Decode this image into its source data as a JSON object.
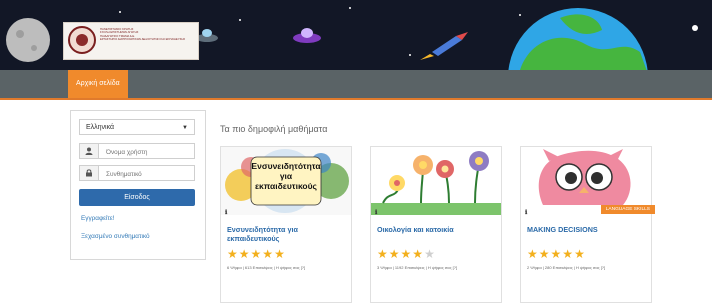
{
  "banner": {
    "logo_lines": [
      "ΠΑΝΕΠΙΣΤΗΜΙΟ ΚΡΗΤΗΣ",
      "ΣΧΟΛΗ ΕΠΙΣΤΗΜΩΝ ΑΓΩΓΗΣ",
      "ΠΑΙΔΑΓΩΓΙΚΟ ΤΜΗΜΑ Δ.Ε.",
      "ΕΡΓΑΣΤΗΡΙΟ ΔΙΑΠΡΟΣΩΠΙΚΩΝ ΔΕΞΙΟΤΗΤΩΝ ΚΑΙ ΕΚΠΑΙΔΕΥΣΗΣ"
    ]
  },
  "nav": {
    "home_label": "Αρχική σελίδα"
  },
  "login": {
    "language_value": "Ελληνικά",
    "username_placeholder": "Όνομα χρήστη",
    "password_placeholder": "Συνθηματικό",
    "login_button": "Είσοδος",
    "register_link": "Εγγραφείτε!",
    "forgot_link": "Ξεχασμένο συνθηματικό"
  },
  "main": {
    "title": "Τα πιο δημοφιλή μαθήματα",
    "courses": [
      {
        "thumb_text": [
          "Ενσυνειδητότητα",
          "για",
          "εκπαιδευτικούς"
        ],
        "title": "Ενσυνειδητότητα για εκπαιδευτικούς",
        "rating": 5,
        "meta": "6 Ψήφοι | 613 Επισκέψεις | Η ψήφος σας [?]"
      },
      {
        "title": "Οικολογία και κατοικία",
        "rating": 4,
        "meta": "3 Ψήφοι | 1192 Επισκέψεις | Η ψήφος σας [?]"
      },
      {
        "badge": "LANGUAGE SKILLS",
        "title": "MAKING DECISIONS",
        "rating": 5,
        "meta": "2 Ψήφοι | 280 Επισκέψεις | Η ψήφος σας [?]"
      }
    ]
  },
  "icons": {
    "user": "user-icon",
    "lock": "lock-icon",
    "chevron": "chevron-down-icon",
    "info": "info-icon"
  },
  "colors": {
    "banner_bg": "#121726",
    "nav_bg": "#5a6366",
    "accent": "#f08a2c",
    "button_blue": "#2e6aab",
    "link_blue": "#337ab7",
    "star": "#f3b01d"
  }
}
